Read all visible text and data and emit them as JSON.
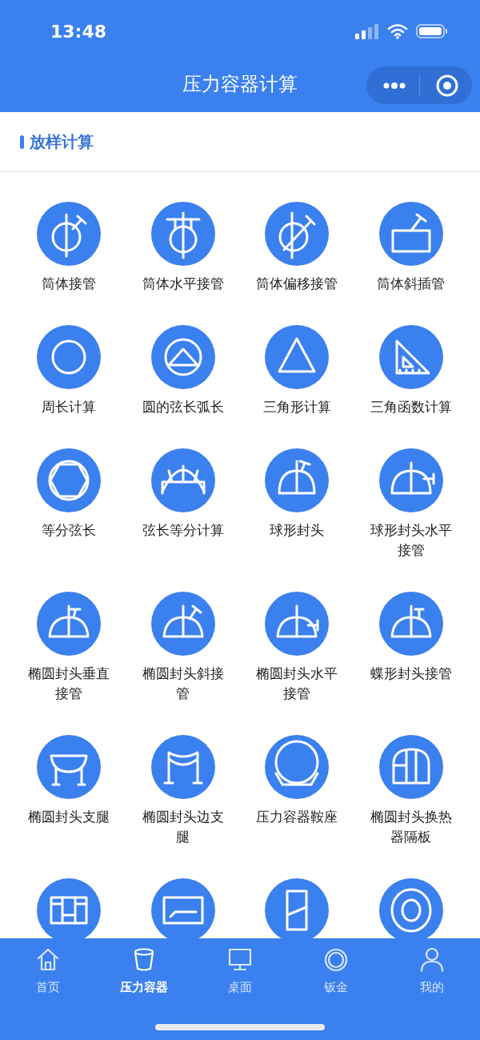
{
  "status_bar": {
    "time": "13:48"
  },
  "nav_bar": {
    "title": "压力容器计算"
  },
  "section": {
    "title": "放样计算"
  },
  "items": [
    {
      "kind": "labeled",
      "label": "筒体接管"
    },
    {
      "kind": "labeled",
      "label": "筒体水平接管"
    },
    {
      "kind": "labeled",
      "label": "筒体偏移接管"
    },
    {
      "kind": "labeled",
      "label": "筒体斜插管"
    },
    {
      "kind": "labeled",
      "label": "周长计算"
    },
    {
      "kind": "labeled",
      "label": "圆的弦长弧长"
    },
    {
      "kind": "labeled",
      "label": "三角形计算"
    },
    {
      "kind": "labeled",
      "label": "三角函数计算"
    },
    {
      "kind": "labeled",
      "label": "等分弦长"
    },
    {
      "kind": "labeled",
      "label": "弦长等分计算"
    },
    {
      "kind": "labeled",
      "label": "球形封头"
    },
    {
      "kind": "labeled",
      "label": "球形封头水平接管"
    },
    {
      "kind": "labeled",
      "label": "椭圆封头垂直接管"
    },
    {
      "kind": "labeled",
      "label": "椭圆封头斜接管"
    },
    {
      "kind": "labeled",
      "label": "椭圆封头水平接管"
    },
    {
      "kind": "labeled",
      "label": "蝶形封头接管"
    },
    {
      "kind": "labeled",
      "label": "椭圆封头支腿"
    },
    {
      "kind": "labeled",
      "label": "椭圆封头边支腿"
    },
    {
      "kind": "labeled",
      "label": "压力容器鞍座"
    },
    {
      "kind": "labeled",
      "label": "椭圆封头换热器隔板"
    },
    {
      "kind": "icon_only"
    },
    {
      "kind": "icon_only"
    },
    {
      "kind": "icon_only"
    },
    {
      "kind": "icon_only"
    }
  ],
  "tab_bar": [
    {
      "label": "首页",
      "selected": false
    },
    {
      "label": "压力容器",
      "selected": true
    },
    {
      "label": "桌面",
      "selected": false
    },
    {
      "label": "钣金",
      "selected": false
    },
    {
      "label": "我的",
      "selected": false
    }
  ]
}
